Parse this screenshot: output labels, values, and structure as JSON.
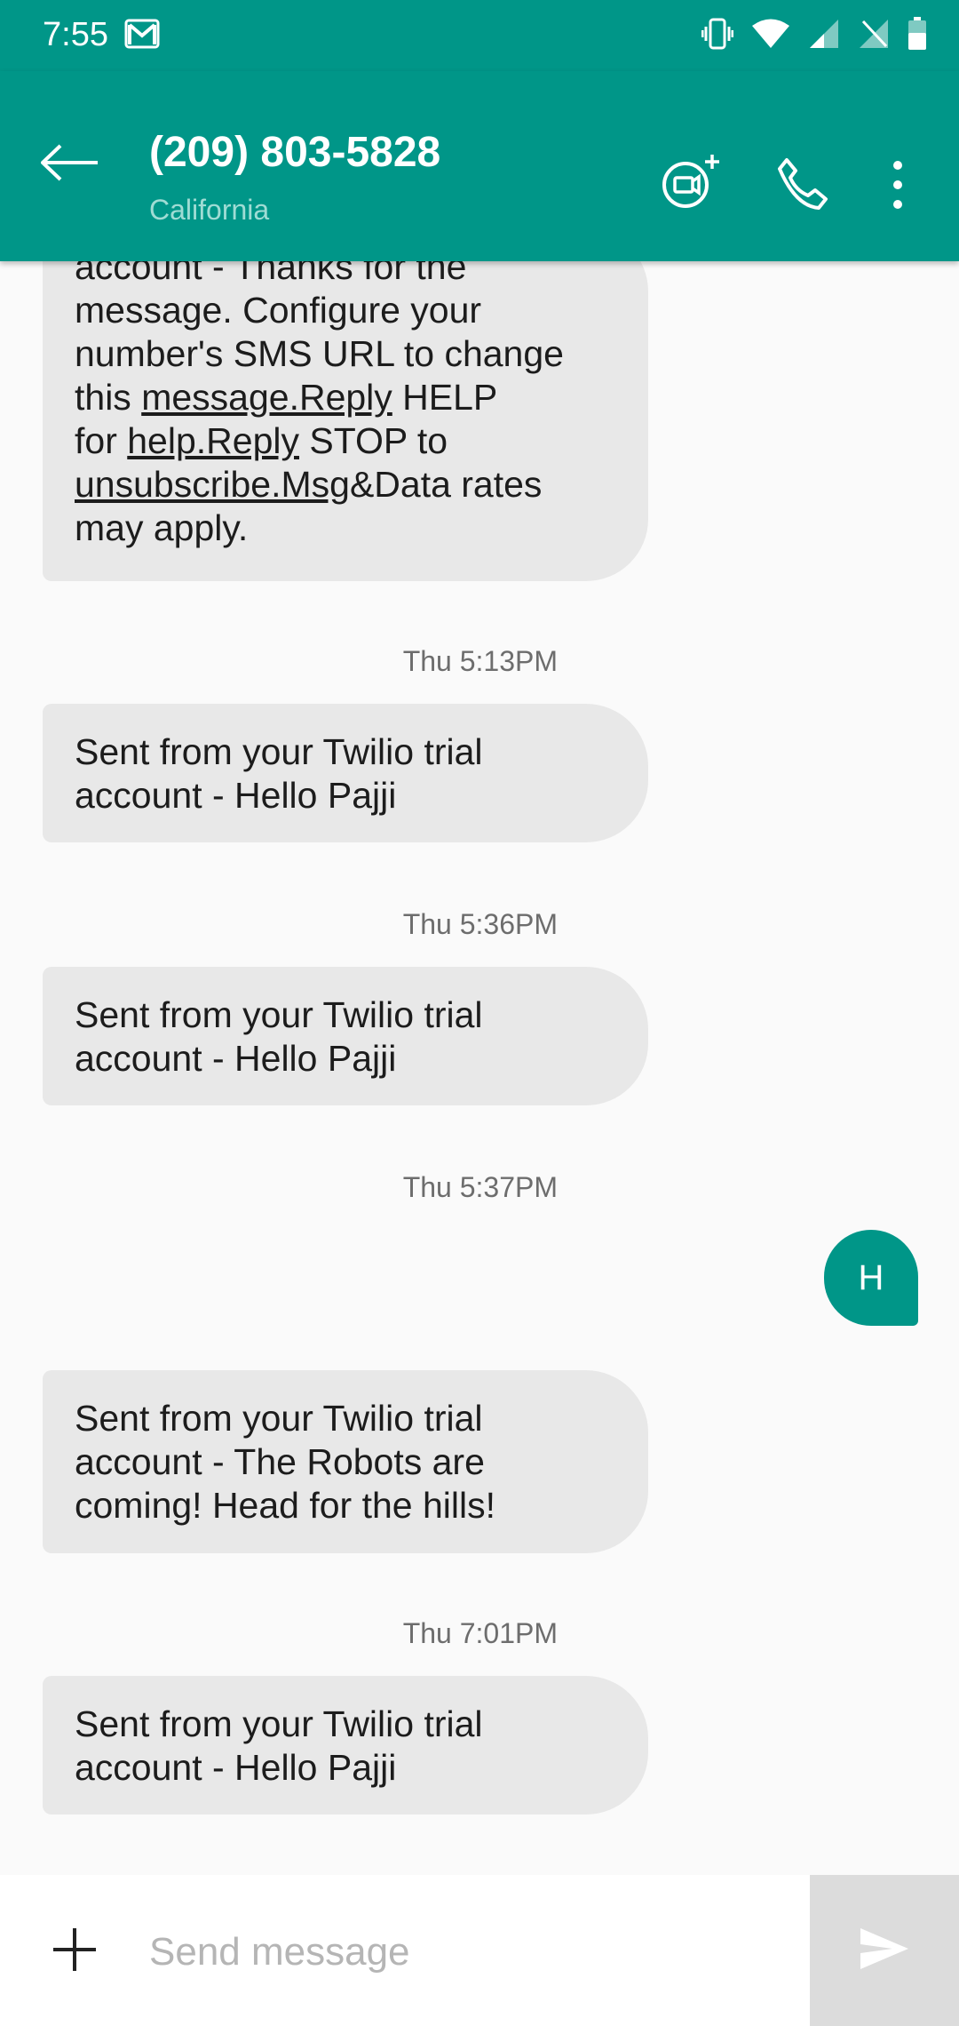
{
  "status_bar": {
    "time": "7:55",
    "icons": [
      "gmail-icon",
      "vibrate-icon",
      "wifi-icon",
      "signal-icon",
      "no-sim-icon",
      "battery-icon"
    ]
  },
  "header": {
    "title": "(209) 803-5828",
    "subtitle": "California",
    "actions": [
      "back-arrow-icon",
      "video-call-add-icon",
      "phone-icon",
      "more-vert-icon"
    ]
  },
  "messages": {
    "m0": {
      "line1": "account - Thanks for the",
      "line2": "message. Configure your",
      "line3": "number's SMS URL to change",
      "line4_pre": "this ",
      "line4_link": "message.Reply",
      "line4_post": " HELP",
      "line5_pre": "for ",
      "line5_link": "help.Reply",
      "line5_post": " STOP to",
      "line6_link": "unsubscribe.Msg",
      "line6_post": "&Data rates",
      "line7": "may apply."
    },
    "ts1": "Thu 5:13PM",
    "m1": {
      "line1": "Sent from your Twilio trial",
      "line2": "account - Hello Pajji"
    },
    "ts2": "Thu 5:36PM",
    "m2": {
      "line1": "Sent from your Twilio trial",
      "line2": "account - Hello Pajji"
    },
    "ts3": "Thu 5:37PM",
    "m3_out": "H",
    "m4": {
      "line1": "Sent from your Twilio trial",
      "line2": "account - The Robots are",
      "line3": "coming! Head for the hills!"
    },
    "ts4": "Thu 7:01PM",
    "m5": {
      "line1": "Sent from your Twilio trial",
      "line2": "account - Hello Pajji"
    }
  },
  "compose": {
    "placeholder": "Send message",
    "value": ""
  },
  "colors": {
    "primary": "#009688",
    "incoming_bubble": "#e8e8e8",
    "send_bg": "#dcdcdc"
  }
}
